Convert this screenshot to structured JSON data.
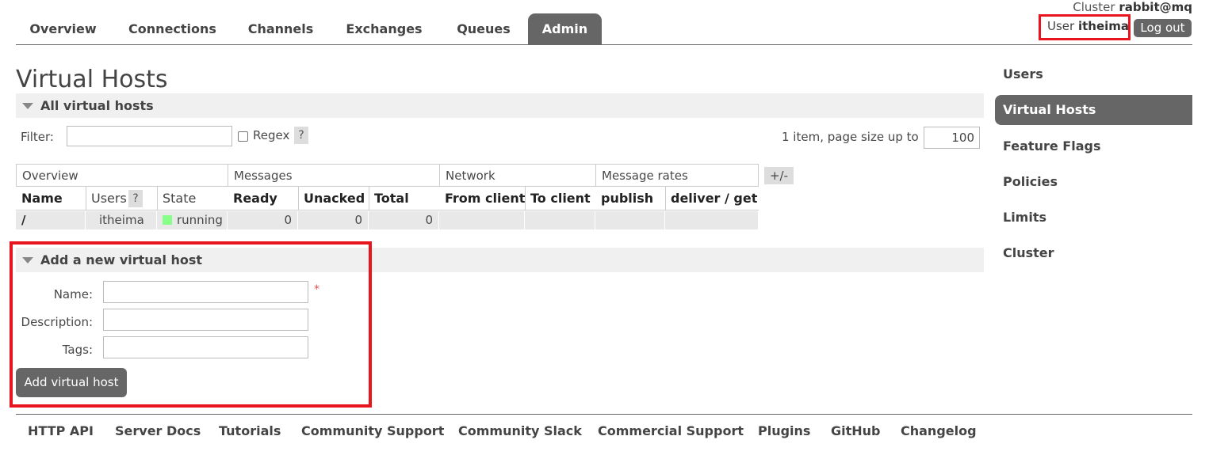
{
  "header": {
    "cluster_label": "Cluster",
    "cluster_name": "rabbit@mq",
    "tabs": [
      "Overview",
      "Connections",
      "Channels",
      "Exchanges",
      "Queues",
      "Admin"
    ],
    "active_tab": "Admin",
    "user_label": "User",
    "user_name": "itheima",
    "logout_label": "Log out"
  },
  "main": {
    "title": "Virtual Hosts",
    "all_section_title": "All virtual hosts",
    "filter_label": "Filter:",
    "filter_value": "",
    "regex_label": "Regex",
    "help_mark": "?",
    "page_info": "1 item, page size up to",
    "page_size": "100",
    "columns_toggle": "+/-",
    "table": {
      "groups": [
        "Overview",
        "Messages",
        "Network",
        "Message rates"
      ],
      "headers": [
        "Name",
        "Users",
        "State",
        "Ready",
        "Unacked",
        "Total",
        "From client",
        "To client",
        "publish",
        "deliver / get"
      ],
      "rows": [
        {
          "name": "/",
          "users": "itheima",
          "state": "running",
          "ready": "0",
          "unacked": "0",
          "total": "0",
          "from_client": "",
          "to_client": "",
          "publish": "",
          "deliver_get": ""
        }
      ]
    },
    "add_section_title": "Add a new virtual host",
    "form": {
      "name_label": "Name:",
      "description_label": "Description:",
      "tags_label": "Tags:",
      "required_mark": "*",
      "submit_label": "Add virtual host"
    }
  },
  "sidebar": {
    "items": [
      "Users",
      "Virtual Hosts",
      "Feature Flags",
      "Policies",
      "Limits",
      "Cluster"
    ],
    "active": "Virtual Hosts"
  },
  "footer": {
    "links": [
      "HTTP API",
      "Server Docs",
      "Tutorials",
      "Community Support",
      "Community Slack",
      "Commercial Support",
      "Plugins",
      "GitHub",
      "Changelog"
    ]
  },
  "colors": {
    "accent_dark": "#666666",
    "highlight_red": "#e8141e",
    "running_green": "#88ff88"
  }
}
